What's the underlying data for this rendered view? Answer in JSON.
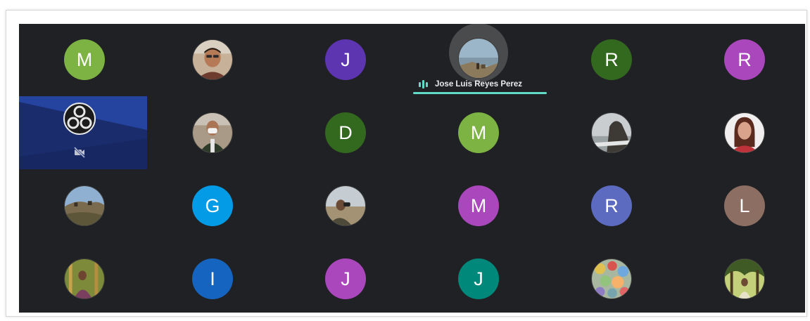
{
  "meeting": {
    "active_speaker": {
      "name": "Jose Luis Reyes Perez",
      "indicator_color": "#5fdbc7"
    },
    "presenter_tile": {
      "icon": "obs-studio-icon",
      "status_icon": "camera-off-icon",
      "background_color": "#1d3480"
    },
    "participants": [
      {
        "initial": "M",
        "color": "#7cb342",
        "type": "initial"
      },
      {
        "initial": "",
        "type": "photo",
        "photo": "man-portrait"
      },
      {
        "initial": "J",
        "color": "#5e35b1",
        "type": "initial"
      },
      {
        "initial": "",
        "type": "photo",
        "photo": "landscape-coast",
        "speaking": true
      },
      {
        "initial": "R",
        "color": "#33691e",
        "type": "initial"
      },
      {
        "initial": "R",
        "color": "#ab47bc",
        "type": "initial"
      },
      {
        "initial": "",
        "type": "presenter"
      },
      {
        "initial": "",
        "type": "photo",
        "photo": "man-mask-vest"
      },
      {
        "initial": "D",
        "color": "#33691e",
        "type": "initial"
      },
      {
        "initial": "M",
        "color": "#7cb342",
        "type": "initial"
      },
      {
        "initial": "",
        "type": "photo",
        "photo": "sea-cliff"
      },
      {
        "initial": "",
        "type": "photo",
        "photo": "woman-portrait"
      },
      {
        "initial": "",
        "type": "photo",
        "photo": "hill-village"
      },
      {
        "initial": "G",
        "color": "#039be5",
        "type": "initial"
      },
      {
        "initial": "",
        "type": "photo",
        "photo": "man-binoculars"
      },
      {
        "initial": "M",
        "color": "#ab47bc",
        "type": "initial"
      },
      {
        "initial": "R",
        "color": "#5c6bc0",
        "type": "initial"
      },
      {
        "initial": "L",
        "color": "#8d6e63",
        "type": "initial"
      },
      {
        "initial": "",
        "type": "photo",
        "photo": "person-forest"
      },
      {
        "initial": "I",
        "color": "#1565c0",
        "type": "initial"
      },
      {
        "initial": "J",
        "color": "#ab47bc",
        "type": "initial"
      },
      {
        "initial": "J",
        "color": "#00897b",
        "type": "initial"
      },
      {
        "initial": "",
        "type": "photo",
        "photo": "colorful-stones"
      },
      {
        "initial": "",
        "type": "photo",
        "photo": "person-trees"
      }
    ]
  }
}
